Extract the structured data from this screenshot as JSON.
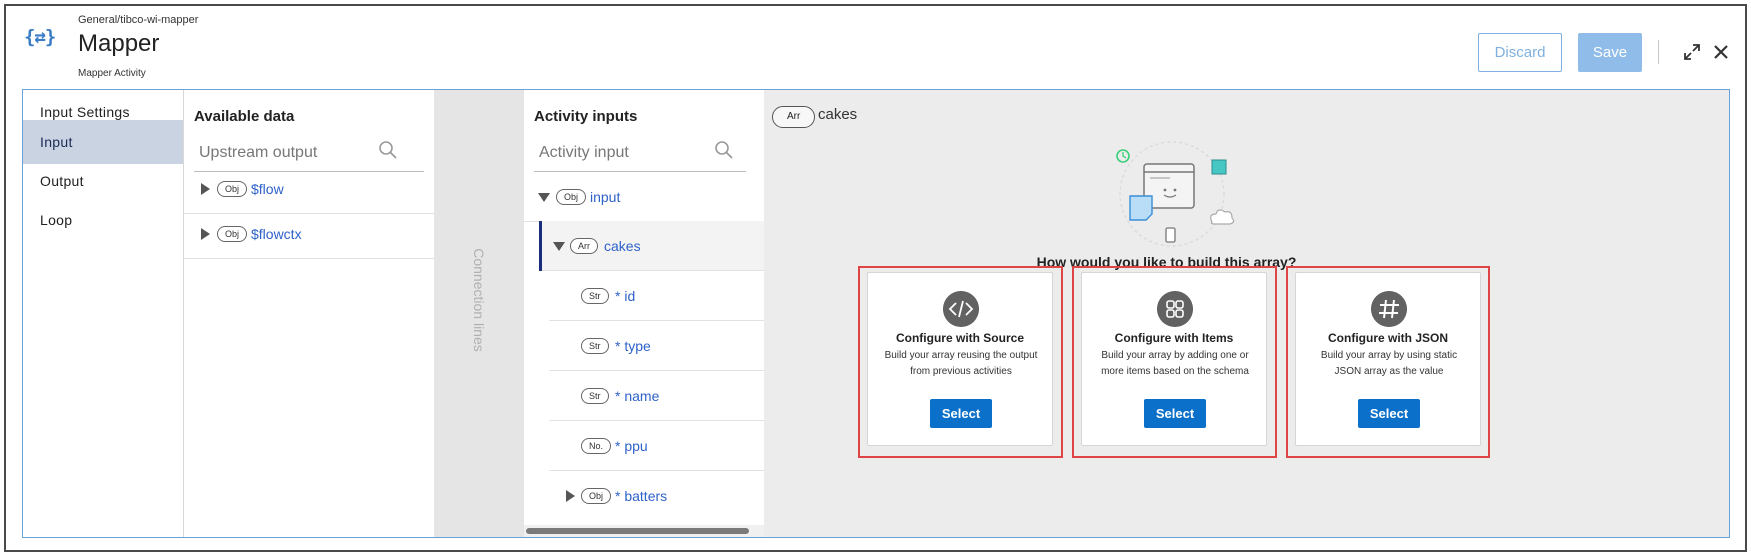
{
  "header": {
    "breadcrumb": "General/tibco-wi-mapper",
    "title": "Mapper",
    "subtitle": "Mapper Activity",
    "app_icon": "{⇄}",
    "discard_label": "Discard",
    "save_label": "Save"
  },
  "sidenav": {
    "items": [
      {
        "label": "Input Settings"
      },
      {
        "label": "Input"
      },
      {
        "label": "Output"
      },
      {
        "label": "Loop"
      }
    ],
    "active": "Input"
  },
  "available": {
    "title": "Available data",
    "search_placeholder": "Upstream output",
    "nodes": [
      {
        "type": "Obj",
        "label": "$flow"
      },
      {
        "type": "Obj",
        "label": "$flowctx"
      }
    ]
  },
  "connection": {
    "label": "Connection lines"
  },
  "activity_inputs": {
    "title": "Activity inputs",
    "search_placeholder": "Activity input",
    "nodes": [
      {
        "type": "Obj",
        "label": "input"
      },
      {
        "type": "Arr",
        "label": "cakes"
      },
      {
        "type": "Str",
        "label": "* id"
      },
      {
        "type": "Str",
        "label": "* type"
      },
      {
        "type": "Str",
        "label": "* name"
      },
      {
        "type": "No.",
        "label": "* ppu"
      },
      {
        "type": "Obj",
        "label": "* batters"
      }
    ]
  },
  "right_pane": {
    "crumb_type": "Arr",
    "crumb_label": "cakes",
    "question": "How would you like to build this array?",
    "cards": [
      {
        "icon": "code-icon",
        "title": "Configure with Source",
        "desc": "Build your array reusing the output from previous activities",
        "button": "Select"
      },
      {
        "icon": "grid-icon",
        "title": "Configure with Items",
        "desc": "Build your array by adding one or more items based on the schema",
        "button": "Select"
      },
      {
        "icon": "hash-icon",
        "title": "Configure with JSON",
        "desc": "Build your array by using static JSON array as the value",
        "button": "Select"
      }
    ],
    "highlight_color": "#e04545",
    "button_color": "#0b70c9"
  }
}
